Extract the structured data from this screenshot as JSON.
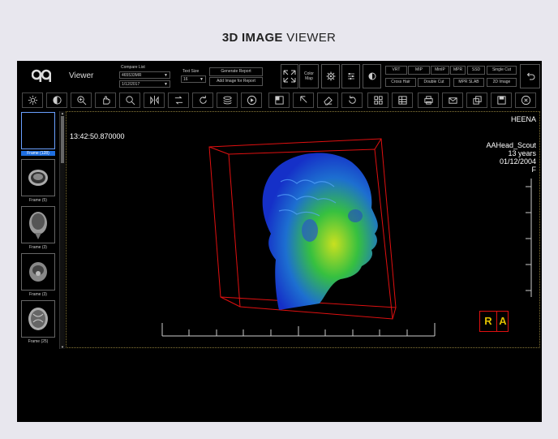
{
  "page_title": {
    "bold": "3D IMAGE",
    "rest": " VIEWER"
  },
  "header": {
    "app_name": "Viewer",
    "compare_list_label": "Compare List",
    "compare_list_value": "465533MR",
    "date_value": "1/12/2017",
    "text_size_label": "Text Size",
    "text_size_value": "16",
    "generate_report_label": "Generate Report",
    "add_image_label": "Add Image for Report",
    "color_map_label": "Color Map",
    "render_buttons": [
      "VRT",
      "MIP",
      "MinIP",
      "MPR",
      "SSD",
      "Single Cut"
    ],
    "render_buttons_row2": [
      "Cross Hair",
      "Double Cut",
      "MPR SLAB",
      "2D Image"
    ]
  },
  "toolbar_icons": [
    "brightness-icon",
    "contrast-icon",
    "zoom-in-icon",
    "pan-icon",
    "magnifier-icon",
    "flip-icon",
    "rotate-flip-icon",
    "rotate-icon",
    "stack-icon",
    "play-icon",
    "invert-icon",
    "pointer-icon",
    "eraser-icon",
    "reset-icon",
    "layout-icon",
    "grid-icon",
    "print-icon",
    "email-icon",
    "export-icon",
    "save-icon",
    "close-icon"
  ],
  "thumbnails": [
    {
      "label": "Frame (128)",
      "selected": true
    },
    {
      "label": "Frame (5)",
      "selected": false
    },
    {
      "label": "Frame (3)",
      "selected": false
    },
    {
      "label": "Frame (3)",
      "selected": false
    },
    {
      "label": "Frame (25)",
      "selected": false
    }
  ],
  "overlay": {
    "timestamp": "13:42:50.870000",
    "patient_name": "HEENA",
    "study": "AAHead_Scout",
    "age": "13 years",
    "date": "01/12/2004",
    "sex": "F",
    "orientation_r": "R",
    "orientation_a": "A"
  },
  "colors": {
    "accent": "#1f6fe0",
    "bbox": "#e01010",
    "orient": "#e0c000"
  }
}
